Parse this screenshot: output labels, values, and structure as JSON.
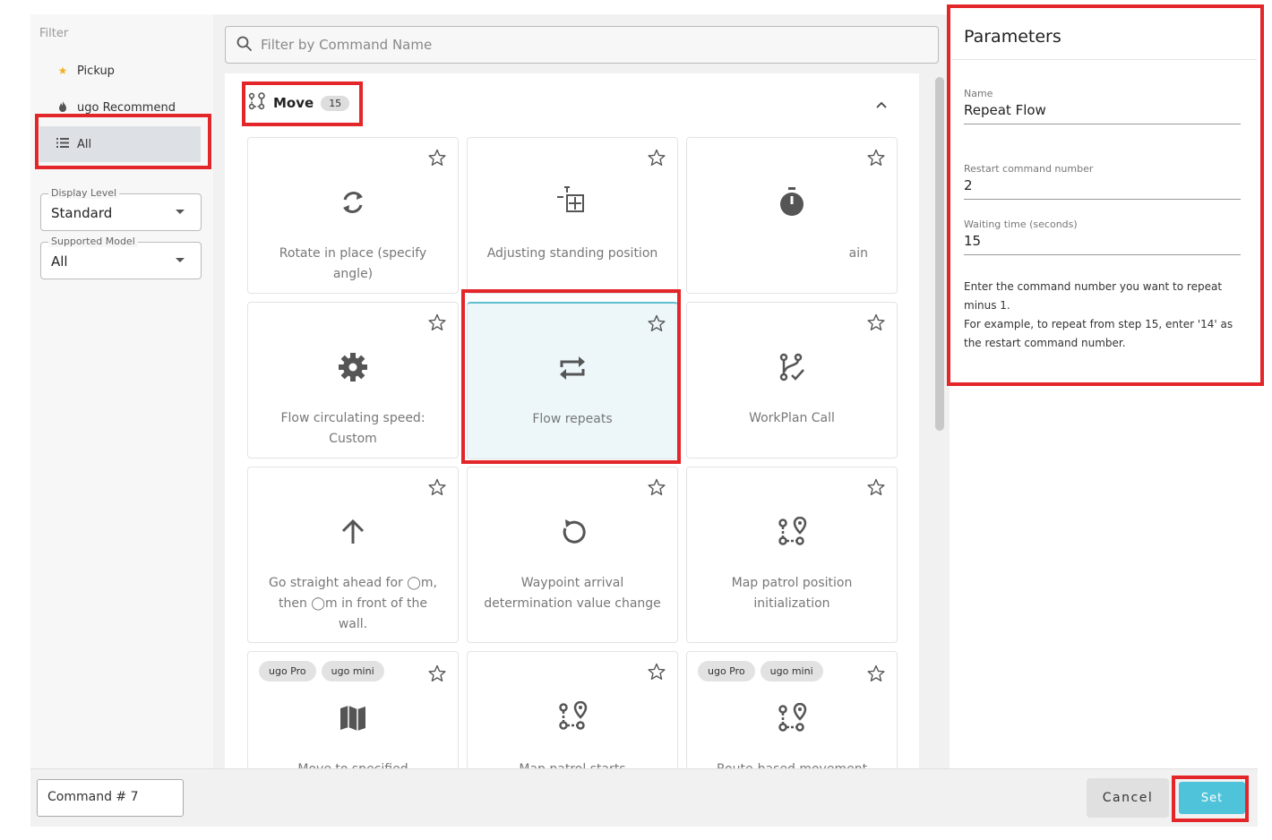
{
  "sidebar": {
    "title": "Filter",
    "items": [
      {
        "label": "Pickup",
        "icon": "star-icon"
      },
      {
        "label": "ugo Recommend",
        "icon": "flame-icon"
      },
      {
        "label": "All",
        "icon": "list-icon",
        "active": true
      }
    ],
    "display_level": {
      "label": "Display Level",
      "value": "Standard"
    },
    "supported_model": {
      "label": "Supported Model",
      "value": "All"
    }
  },
  "search": {
    "placeholder": "Filter by Command Name"
  },
  "group": {
    "label": "Move",
    "count": "15"
  },
  "cards": [
    {
      "label": "Rotate in place (specify angle)",
      "icon": "rotate-icon"
    },
    {
      "label": "Adjusting standing position",
      "icon": "adjust-position-icon"
    },
    {
      "label": "ain",
      "icon": "timer-icon"
    },
    {
      "label": "Flow circulating speed: Custom",
      "icon": "gear-icon"
    },
    {
      "label": "Flow repeats",
      "icon": "repeat-icon",
      "selected": true
    },
    {
      "label": "WorkPlan Call",
      "icon": "workplan-icon"
    },
    {
      "label": "Go straight ahead for ◯m, then ◯m in front of the wall.",
      "icon": "arrow-up-icon"
    },
    {
      "label": "Waypoint arrival determination value change",
      "icon": "refresh-icon"
    },
    {
      "label": "Map patrol position initialization",
      "icon": "route-icon"
    },
    {
      "label": "Move to specified",
      "icon": "map-icon",
      "chips": [
        "ugo Pro",
        "ugo mini"
      ]
    },
    {
      "label": "Map patrol starts",
      "icon": "route-icon"
    },
    {
      "label": "Route-based movement",
      "icon": "route-icon",
      "chips": [
        "ugo Pro",
        "ugo mini"
      ]
    }
  ],
  "parameters": {
    "title": "Parameters",
    "fields": [
      {
        "label": "Name",
        "value": "Repeat Flow"
      },
      {
        "label": "Restart command number",
        "value": "2"
      },
      {
        "label": "Waiting time (seconds)",
        "value": "15"
      }
    ],
    "help_lines": [
      "Enter the command number you want to repeat minus 1.",
      "For example, to repeat from step 15, enter '14' as the restart command number."
    ]
  },
  "footer": {
    "command": "Command # 7",
    "cancel_label": "Cancel",
    "set_label": "Set"
  },
  "colors": {
    "accent": "#4fc3d9",
    "highlight": "#e3262a",
    "selected_bg": "#edf7fa"
  }
}
